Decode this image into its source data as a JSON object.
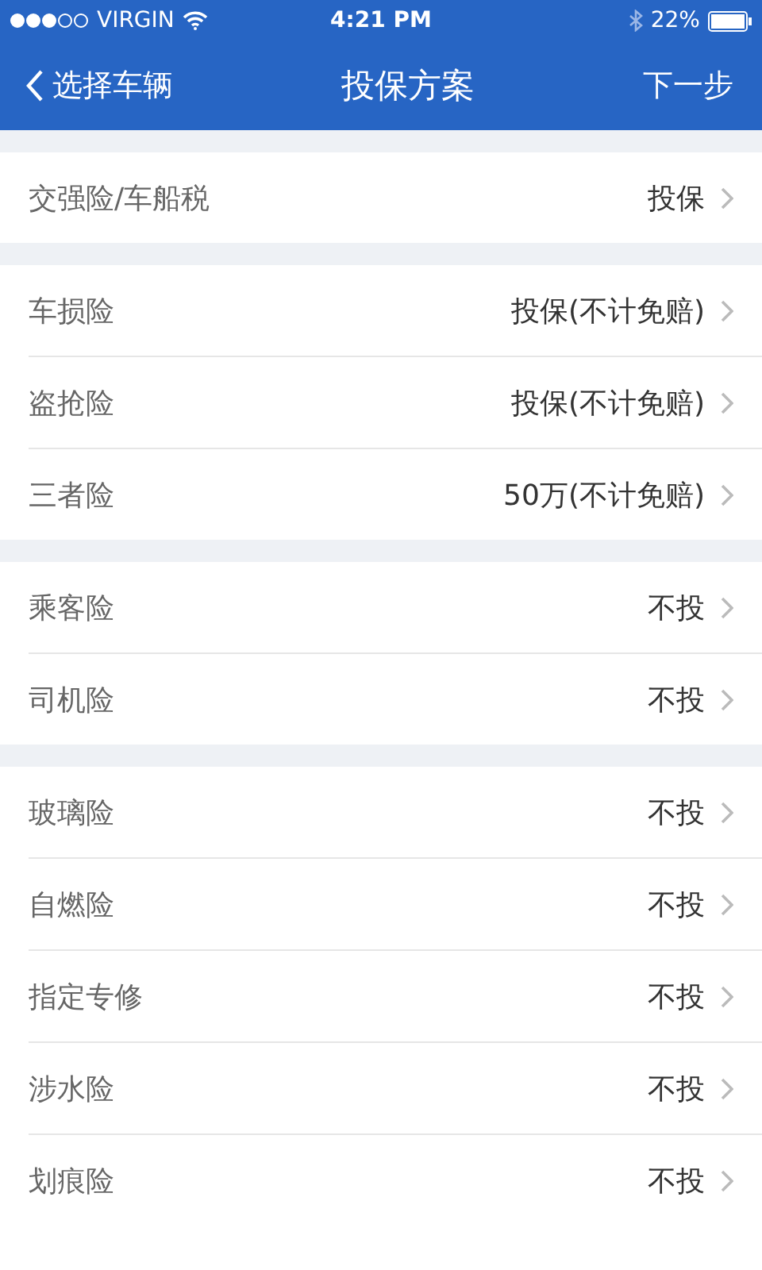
{
  "status_bar": {
    "carrier": "VIRGIN",
    "time": "4:21 PM",
    "battery": "22%"
  },
  "nav": {
    "back": "选择车辆",
    "title": "投保方案",
    "next": "下一步"
  },
  "groups": [
    {
      "rows": [
        {
          "label": "交强险/车船税",
          "value": "投保"
        }
      ]
    },
    {
      "rows": [
        {
          "label": "车损险",
          "value": "投保(不计免赔)"
        },
        {
          "label": "盗抢险",
          "value": "投保(不计免赔)"
        },
        {
          "label": "三者险",
          "value": "50万(不计免赔)"
        }
      ]
    },
    {
      "rows": [
        {
          "label": "乘客险",
          "value": "不投"
        },
        {
          "label": "司机险",
          "value": "不投"
        }
      ]
    },
    {
      "rows": [
        {
          "label": "玻璃险",
          "value": "不投"
        },
        {
          "label": "自燃险",
          "value": "不投"
        },
        {
          "label": "指定专修",
          "value": "不投"
        },
        {
          "label": "涉水险",
          "value": "不投"
        },
        {
          "label": "划痕险",
          "value": "不投"
        }
      ]
    }
  ]
}
